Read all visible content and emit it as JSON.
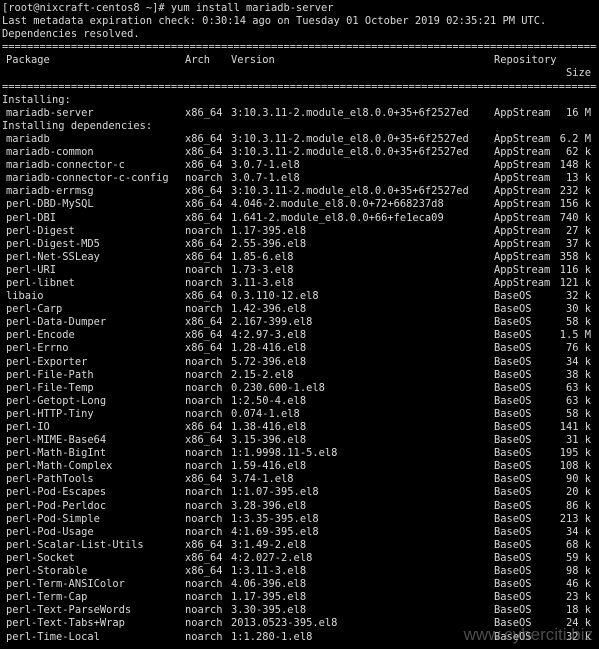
{
  "prompt": "[root@nixcraft-centos8 ~]# yum install mariadb-server",
  "metadata_line": "Last metadata expiration check: 0:30:14 ago on Tuesday 01 October 2019 02:35:21 PM UTC.",
  "deps_resolved": "Dependencies resolved.",
  "separator_char": "=",
  "headers": {
    "package": "Package",
    "arch": "Arch",
    "version": "Version",
    "repository": "Repository",
    "size": "Size"
  },
  "installing_label": "Installing:",
  "installing": [
    [
      "mariadb-server",
      "x86_64",
      "3:10.3.11-2.module_el8.0.0+35+6f2527ed",
      "AppStream",
      "16 M"
    ]
  ],
  "installing_deps_label": "Installing dependencies:",
  "dependencies": [
    [
      "mariadb",
      "x86_64",
      "3:10.3.11-2.module_el8.0.0+35+6f2527ed",
      "AppStream",
      "6.2 M"
    ],
    [
      "mariadb-common",
      "x86_64",
      "3:10.3.11-2.module_el8.0.0+35+6f2527ed",
      "AppStream",
      "62 k"
    ],
    [
      "mariadb-connector-c",
      "x86_64",
      "3.0.7-1.el8",
      "AppStream",
      "148 k"
    ],
    [
      "mariadb-connector-c-config",
      "noarch",
      "3.0.7-1.el8",
      "AppStream",
      "13 k"
    ],
    [
      "mariadb-errmsg",
      "x86_64",
      "3:10.3.11-2.module_el8.0.0+35+6f2527ed",
      "AppStream",
      "232 k"
    ],
    [
      "perl-DBD-MySQL",
      "x86_64",
      "4.046-2.module_el8.0.0+72+668237d8",
      "AppStream",
      "156 k"
    ],
    [
      "perl-DBI",
      "x86_64",
      "1.641-2.module_el8.0.0+66+fe1eca09",
      "AppStream",
      "740 k"
    ],
    [
      "perl-Digest",
      "noarch",
      "1.17-395.el8",
      "AppStream",
      "27 k"
    ],
    [
      "perl-Digest-MD5",
      "x86_64",
      "2.55-396.el8",
      "AppStream",
      "37 k"
    ],
    [
      "perl-Net-SSLeay",
      "x86_64",
      "1.85-6.el8",
      "AppStream",
      "358 k"
    ],
    [
      "perl-URI",
      "noarch",
      "1.73-3.el8",
      "AppStream",
      "116 k"
    ],
    [
      "perl-libnet",
      "noarch",
      "3.11-3.el8",
      "AppStream",
      "121 k"
    ],
    [
      "libaio",
      "x86_64",
      "0.3.110-12.el8",
      "BaseOS",
      "32 k"
    ],
    [
      "perl-Carp",
      "noarch",
      "1.42-396.el8",
      "BaseOS",
      "30 k"
    ],
    [
      "perl-Data-Dumper",
      "x86_64",
      "2.167-399.el8",
      "BaseOS",
      "58 k"
    ],
    [
      "perl-Encode",
      "x86_64",
      "4:2.97-3.el8",
      "BaseOS",
      "1.5 M"
    ],
    [
      "perl-Errno",
      "x86_64",
      "1.28-416.el8",
      "BaseOS",
      "76 k"
    ],
    [
      "perl-Exporter",
      "noarch",
      "5.72-396.el8",
      "BaseOS",
      "34 k"
    ],
    [
      "perl-File-Path",
      "noarch",
      "2.15-2.el8",
      "BaseOS",
      "38 k"
    ],
    [
      "perl-File-Temp",
      "noarch",
      "0.230.600-1.el8",
      "BaseOS",
      "63 k"
    ],
    [
      "perl-Getopt-Long",
      "noarch",
      "1:2.50-4.el8",
      "BaseOS",
      "63 k"
    ],
    [
      "perl-HTTP-Tiny",
      "noarch",
      "0.074-1.el8",
      "BaseOS",
      "58 k"
    ],
    [
      "perl-IO",
      "x86_64",
      "1.38-416.el8",
      "BaseOS",
      "141 k"
    ],
    [
      "perl-MIME-Base64",
      "x86_64",
      "3.15-396.el8",
      "BaseOS",
      "31 k"
    ],
    [
      "perl-Math-BigInt",
      "noarch",
      "1:1.9998.11-5.el8",
      "BaseOS",
      "195 k"
    ],
    [
      "perl-Math-Complex",
      "noarch",
      "1.59-416.el8",
      "BaseOS",
      "108 k"
    ],
    [
      "perl-PathTools",
      "x86_64",
      "3.74-1.el8",
      "BaseOS",
      "90 k"
    ],
    [
      "perl-Pod-Escapes",
      "noarch",
      "1:1.07-395.el8",
      "BaseOS",
      "20 k"
    ],
    [
      "perl-Pod-Perldoc",
      "noarch",
      "3.28-396.el8",
      "BaseOS",
      "86 k"
    ],
    [
      "perl-Pod-Simple",
      "noarch",
      "1:3.35-395.el8",
      "BaseOS",
      "213 k"
    ],
    [
      "perl-Pod-Usage",
      "noarch",
      "4:1.69-395.el8",
      "BaseOS",
      "34 k"
    ],
    [
      "perl-Scalar-List-Utils",
      "x86_64",
      "3:1.49-2.el8",
      "BaseOS",
      "68 k"
    ],
    [
      "perl-Socket",
      "x86_64",
      "4:2.027-2.el8",
      "BaseOS",
      "59 k"
    ],
    [
      "perl-Storable",
      "x86_64",
      "1:3.11-3.el8",
      "BaseOS",
      "98 k"
    ],
    [
      "perl-Term-ANSIColor",
      "noarch",
      "4.06-396.el8",
      "BaseOS",
      "46 k"
    ],
    [
      "perl-Term-Cap",
      "noarch",
      "1.17-395.el8",
      "BaseOS",
      "23 k"
    ],
    [
      "perl-Text-ParseWords",
      "noarch",
      "3.30-395.el8",
      "BaseOS",
      "18 k"
    ],
    [
      "perl-Text-Tabs+Wrap",
      "noarch",
      "2013.0523-395.el8",
      "BaseOS",
      "24 k"
    ],
    [
      "perl-Time-Local",
      "noarch",
      "1:1.280-1.el8",
      "BaseOS",
      "32 k"
    ]
  ],
  "watermark": "www.cyberciti.biz",
  "colors": {
    "background": "#000000",
    "text": "#d8d8d8"
  }
}
